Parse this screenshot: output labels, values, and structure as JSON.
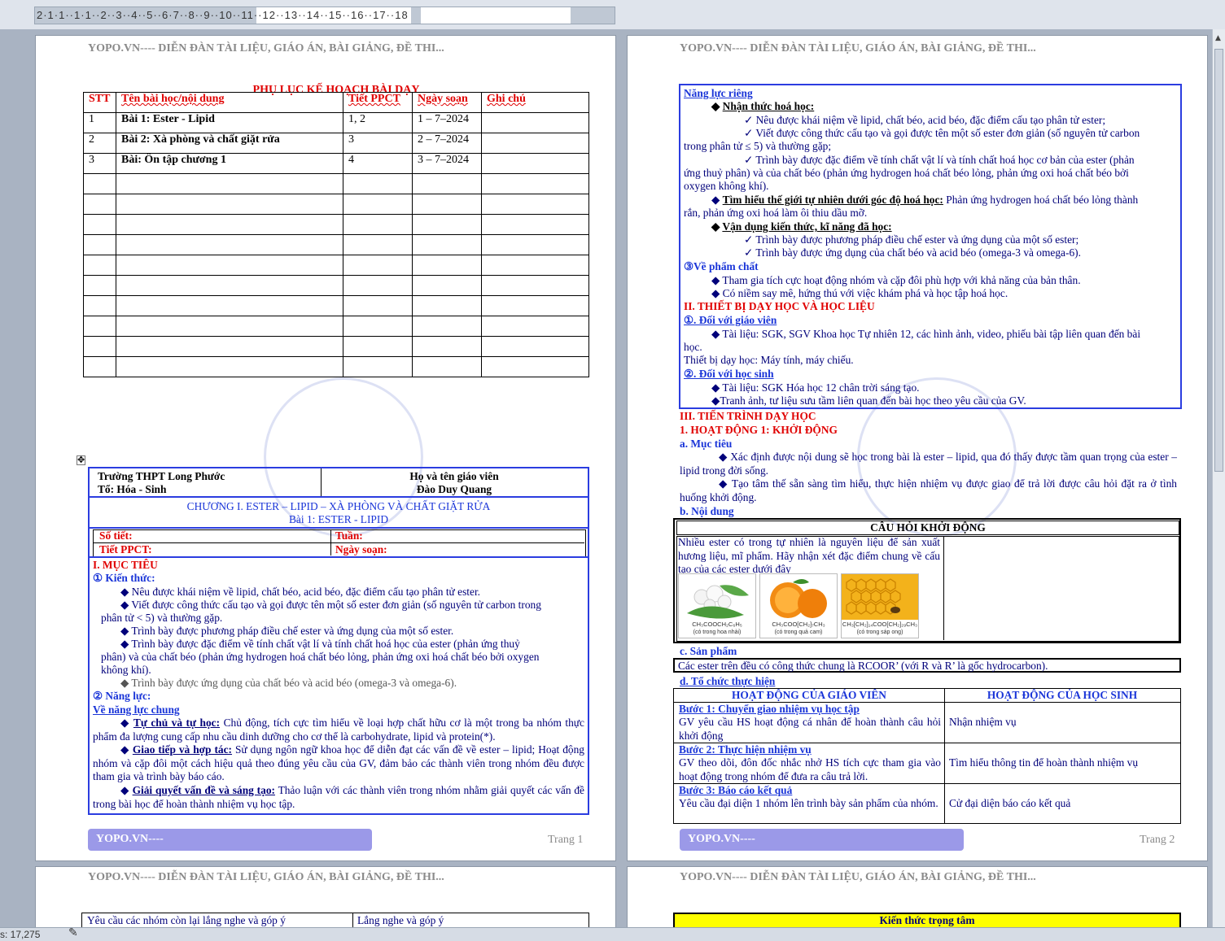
{
  "ruler": {
    "numbers": "2·1·1··1·1··2··3··4··5··6·7··8··9··10··11··12··13··14··15··16··17··18"
  },
  "header_text": "YOPO.VN---- DIỄN ĐÀN TÀI LIỆU, GIÁO ÁN, BÀI GIẢNG, ĐỀ THI...",
  "footer_text": "YOPO.VN----",
  "status_text": "s: 17,275",
  "page1": {
    "plan_title": "PHỤ LỤC KẾ HOẠCH BÀI DẠY",
    "plan_columns": [
      "STT",
      "Tên bài học/nội dung",
      "Tiết PPCT",
      "Ngày soạn",
      "Ghi chú"
    ],
    "plan_rows": [
      [
        "1",
        "Bài 1: Ester - Lipid",
        "1, 2",
        "1 – 7–2024",
        ""
      ],
      [
        "2",
        "Bài 2: Xà phòng và chất giặt rửa",
        "3",
        "2 – 7–2024",
        ""
      ],
      [
        "3",
        "Bài: Ôn tập chương 1",
        "4",
        "3 – 7–2024",
        ""
      ],
      [
        "",
        "",
        "",
        "",
        ""
      ],
      [
        "",
        "",
        "",
        "",
        ""
      ],
      [
        "",
        "",
        "",
        "",
        ""
      ],
      [
        "",
        "",
        "",
        "",
        ""
      ],
      [
        "",
        "",
        "",
        "",
        ""
      ],
      [
        "",
        "",
        "",
        "",
        ""
      ],
      [
        "",
        "",
        "",
        "",
        ""
      ],
      [
        "",
        "",
        "",
        "",
        ""
      ],
      [
        "",
        "",
        "",
        "",
        ""
      ],
      [
        "",
        "",
        "",
        "",
        ""
      ]
    ],
    "school": "Trường THPT Long Phước",
    "group": "Tổ: Hóa - Sinh",
    "teacher_label": "Họ và tên giáo viên",
    "teacher_name": "Đào Duy Quang",
    "chapter": "CHƯƠNG I. ESTER – LIPID – XÀ PHÒNG VÀ CHẤT GIẶT RỬA",
    "lesson": "Bài 1: ESTER - LIPID",
    "so_tiet": "Số tiết:",
    "tuan": "Tuần:",
    "tiet_ppct": "Tiết PPCT:",
    "ngay_soan": "Ngày soạn:",
    "sec1": "I. MỤC TIÊU",
    "kien_thuc": "① Kiến thức:",
    "kt_items": [
      "Nêu được khái niệm về lipid, chất béo, acid béo, đặc điểm cấu tạo phân tử ester.",
      "Viết được công thức cấu tạo và gọi được tên một số ester đơn giản (số nguyên tử carbon trong",
      "phân tử < 5) và thường gặp.",
      "Trình bày được phương pháp điều chế ester và ứng dụng của một số ester.",
      "Trình bày được đặc điểm về tính chất vật lí và tính chất hoá học của ester (phản ứng thuỷ",
      "phân) và của chất béo (phản ứng hydrogen hoá chất béo lỏng, phản ứng oxi hoá chất béo bởi oxygen",
      "không khí).",
      "Trình bày được ứng dụng của chất béo và acid béo (omega-3 và omega-6)."
    ],
    "nang_luc": "② Năng lực:",
    "nl_chung": "Về năng lực chung",
    "tu_chu_label": "Tự chủ và tự học:",
    "tu_chu_text": "Chủ động, tích cực tìm hiểu về loại hợp chất hữu cơ là một trong ba nhóm thực phẩm đa lượng cung cấp nhu cầu dinh dưỡng cho cơ thể là carbohydrate, lipid và protein(*).",
    "giao_tiep_label": "Giao tiếp và hợp tác:",
    "giao_tiep_text": "Sử dụng ngôn ngữ khoa học để diễn đạt các vấn đề về ester – lipid; Hoạt động nhóm và cặp đôi một cách hiệu quả theo đúng yêu cầu của GV, đảm bảo các thành viên trong nhóm đều được tham gia và trình bày báo cáo.",
    "gqvd_label": "Giải quyết vấn đề và sáng tạo:",
    "gqvd_text": "Thảo luận với các thành viên trong nhóm nhằm giải quyết các vấn đề trong bài học để hoàn thành nhiệm vụ học tập.",
    "page_label": "Trang 1"
  },
  "page2": {
    "nl_rieng": "Năng lực riêng",
    "nhan_thuc": "Nhận thức hoá học:",
    "nt_items": [
      "Nêu được khái niệm về lipid, chất béo, acid béo, đặc điểm cấu tạo phân tử ester;",
      "Viết được công thức cấu tạo và gọi được tên một số ester đơn giản (số nguyên tử carbon",
      "trong phân tử ≤ 5) và thường gặp;",
      "Trình bày được đặc điểm về tính chất vật lí và tính chất hoá học cơ bản của ester (phản",
      "ứng thuỷ phân) và của chất béo (phản ứng hydrogen hoá chất béo lỏng, phản ứng oxi hoá chất béo bởi",
      "oxygen không khí)."
    ],
    "tim_hieu_label": "Tìm hiểu thế giới tự nhiên dưới góc độ hoá học:",
    "tim_hieu_text1": "Phản ứng hydrogen hoá chất béo lỏng thành",
    "tim_hieu_text2": "rắn, phản ứng oxi hoá làm ôi thiu dầu mỡ.",
    "van_dung": "Vận dụng kiến thức, kĩ năng đã học:",
    "vd_items": [
      "Trình bày được phương pháp điều chế ester và ứng dụng của một số ester;",
      "Trình bày được ứng dụng của chất béo và acid béo (omega-3 và omega-6)."
    ],
    "pham_chat": "③Về phẩm chất",
    "pc_items": [
      "Tham gia tích cực hoạt động nhóm và cặp đôi phù hợp với khả năng của bản thân.",
      "Có niềm say mê, hứng thú với việc khám phá và học tập hoá học."
    ],
    "sec2": "II. THIẾT BỊ DẠY HỌC VÀ HỌC LIỆU",
    "doi_voi_gv": "①. Đối với giáo viên",
    "gv_tai_lieu1": "Tài liệu: SGK, SGV Khoa học Tự nhiên 12, các hình ảnh, video, phiếu bài tập liên quan đến bài",
    "gv_tai_lieu2": "học.",
    "gv_thiet_bi": "Thiết bị dạy học: Máy tính, máy chiếu.",
    "doi_voi_hs": "②. Đối với học sinh",
    "hs_tai_lieu": "Tài liệu: SGK Hóa học 12 chân trời sáng tạo.",
    "hs_tranh": "Tranh ảnh, tư liệu sưu tầm liên quan đến bài học theo yêu cầu của GV.",
    "sec3": "III. TIẾN TRÌNH DẠY HỌC",
    "hd1": "1. HOẠT ĐỘNG 1: KHỞI ĐỘNG",
    "muc_tieu": "a. Mục tiêu",
    "mt_item1": "Xác định được nội dung sẽ học trong bài là ester – lipid, qua đó thấy được tầm quan trọng của ester – lipid trong đời sống.",
    "mt_item2": "Tạo tâm thế sẵn sàng tìm hiểu, thực hiện nhiệm vụ được giao để trả lời được câu hỏi đặt ra ở tình huống khởi động.",
    "noi_dung": "b. Nội dung",
    "cau_hoi_title": "CÂU HỎI KHỞI ĐỘNG",
    "cau_hoi_text": "Nhiều ester có trong tự nhiên là nguyên liệu để sản xuất hương liệu, mĩ phẩm. Hãy nhận xét đặc điểm chung về cấu tạo của các ester dưới đây",
    "images": [
      {
        "formula": "CH₃COOCH₂C₆H₅",
        "caption": "(có trong hoa nhài)"
      },
      {
        "formula": "CH₃COO[CH₂]₇CH₃",
        "caption": "(có trong quả cam)"
      },
      {
        "formula": "CH₃[CH₂]₁₄COO[CH₂]₂₉CH₃",
        "caption": "(có trong sáp ong)"
      }
    ],
    "san_pham": "c. Sản phẩm",
    "san_pham_text": "Các ester trên đều có công thức chung là RCOOR’ (với R và R’ là gốc hydrocarbon).",
    "to_chuc": "d. Tổ chức thực hiện",
    "col_gv": "HOẠT ĐỘNG CỦA GIÁO VIÊN",
    "col_hs": "HOẠT ĐỘNG CỦA HỌC SINH",
    "steps": [
      {
        "title": "Bước 1: Chuyển giao nhiệm vụ học tập",
        "gv": "GV yêu cầu HS hoạt động cá nhân để hoàn thành câu hỏi khởi động",
        "hs": "Nhận nhiệm vụ"
      },
      {
        "title": "Bước 2: Thực hiện nhiệm vụ",
        "gv": "GV theo dõi, đôn đốc nhắc nhở HS tích cực tham gia vào hoạt động trong nhóm để đưa ra câu trả lời.",
        "hs": "Tìm hiểu thông tin để hoàn thành nhiệm vụ"
      },
      {
        "title": "Bước 3: Báo cáo kết quả",
        "gv": "Yêu cầu đại diện 1 nhóm lên trình bày sản phẩm của nhóm.",
        "hs": "Cử đại diện báo cáo kết quả"
      }
    ],
    "page_label": "Trang 2"
  },
  "page3": {
    "row_gv": "Yêu cầu các nhóm còn lại lắng nghe và góp ý",
    "row_hs": "Lắng nghe và góp ý"
  },
  "page4": {
    "kien_thuc_trong_tam": "Kiến thức trọng tâm"
  }
}
